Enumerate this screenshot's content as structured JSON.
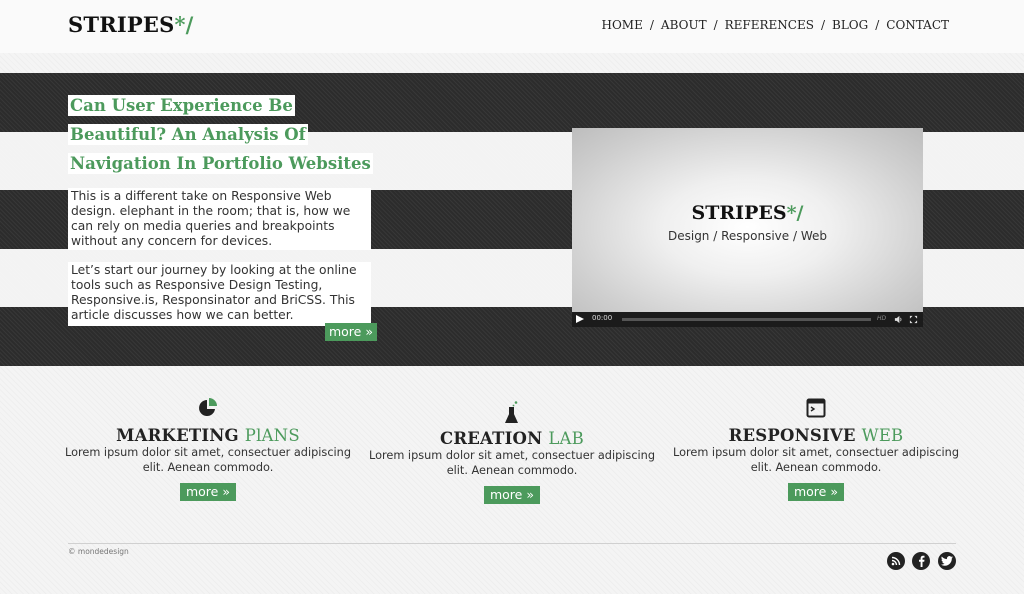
{
  "brand": {
    "name": "STRIPES",
    "mark": "*/"
  },
  "nav": {
    "items": [
      "HOME",
      "ABOUT",
      "REFERENCES",
      "BLOG",
      "CONTACT"
    ]
  },
  "hero": {
    "headline_lines": [
      "Can User Experience Be",
      "Beautiful? An Analysis Of",
      "Navigation In Portfolio Websites"
    ],
    "paragraph1": "This is a different take on Responsive Web design. elephant in the room; that is, how we can rely on media queries and breakpoints without any concern for devices.",
    "paragraph2": "Let’s start our journey by looking at the online tools such as Responsive Design Testing, Responsive.is, Responsinator and BriCSS. This article discusses how we can better.",
    "more_label": "more »"
  },
  "video": {
    "brand": "STRIPES",
    "mark": "*/",
    "tagline": "Design / Responsive / Web",
    "time": "00:00",
    "hd_label": "HD"
  },
  "features": [
    {
      "icon": "pie-chart-icon",
      "title_main": "MARKETING",
      "title_accent": "PlANS",
      "text": "Lorem ipsum dolor sit amet, consectuer adipiscing elit. Aenean commodo.",
      "more_label": "more »"
    },
    {
      "icon": "flask-icon",
      "title_main": "CREATION",
      "title_accent": "LAB",
      "text": "Lorem ipsum dolor sit amet, consectuer adipiscing elit. Aenean commodo.",
      "more_label": "more »"
    },
    {
      "icon": "terminal-window-icon",
      "title_main": "RESPONSIVE",
      "title_accent": "WEB",
      "text": "Lorem ipsum dolor sit amet, consectuer adipiscing elit. Aenean commodo.",
      "more_label": "more »"
    }
  ],
  "footer": {
    "copyright": "© mondedesign",
    "social": [
      "rss-icon",
      "facebook-icon",
      "twitter-icon"
    ]
  },
  "colors": {
    "accent": "#4c9a5c",
    "dark_stripe": "#2c2c2c"
  }
}
